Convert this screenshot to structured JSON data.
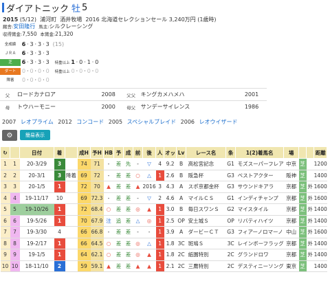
{
  "horse": {
    "name": "ダイアトニック",
    "sex": "牡",
    "age": "5",
    "birth": "2015",
    "birth_md": "(5/12)",
    "area": "浦河町",
    "breeder": "酒井牧場",
    "sale": "2016 北海道セレクションセール 3,240万円 (1歳時)",
    "trainer_label": "厩舎:",
    "trainer": "安田隆行",
    "owner_label": "馬主:",
    "owner": "シルクレーシング",
    "prize_label1": "収得賞金:",
    "prize1": "7,550",
    "prize_label2": "本賞金:",
    "prize2": "21,320"
  },
  "records": [
    {
      "cat": "全成績",
      "a": "6",
      "b": "3",
      "c": "3",
      "d": "3",
      "total": "(15)",
      "style": "plain"
    },
    {
      "cat": "ＪＲＡ",
      "a": "6",
      "b": "3",
      "c": "3",
      "d": "3",
      "total": "",
      "style": "plain"
    },
    {
      "cat": "芝",
      "a": "6",
      "b": "3",
      "c": "3",
      "d": "3",
      "sub": "特重以上",
      "sa": "1",
      "sb": "0",
      "sc": "1",
      "sd": "0",
      "style": "turf"
    },
    {
      "cat": "ダート",
      "a": "0",
      "b": "0",
      "c": "0",
      "d": "0",
      "sub": "特重以上",
      "sa": "0",
      "sb": "0",
      "sc": "0",
      "sd": "0",
      "style": "dirt"
    },
    {
      "cat": "障害",
      "a": "0",
      "b": "0",
      "c": "0",
      "d": "0",
      "total": "",
      "style": "plain"
    }
  ],
  "pedigree": [
    {
      "label": "父",
      "name": "ロードカナロア",
      "year": "2008",
      "label2": "父父",
      "name2": "キングカメハメハ",
      "year2": "2001"
    },
    {
      "label": "母",
      "name": "トウハーモニー",
      "year": "2000",
      "label2": "母父",
      "name2": "サンデーサイレンス",
      "year2": "1986"
    }
  ],
  "grandsibs": [
    {
      "year": "2007",
      "name": "レオプライム"
    },
    {
      "year": "2012",
      "name": "コンコード"
    },
    {
      "year": "2005",
      "name": "スペシャルブレイド"
    },
    {
      "year": "2006",
      "name": "レオウイザード"
    }
  ],
  "buttons": {
    "simple": "簡易表示",
    "gear": "⚙"
  },
  "table": {
    "headers": [
      "↻",
      "",
      "日付",
      "着",
      "",
      "成H",
      "予H",
      "HB",
      "予",
      "成",
      "前",
      "後",
      "人",
      "オッ",
      "Lv",
      "レース名",
      "条",
      "1(2)着馬名",
      "場",
      "",
      "",
      "距離"
    ],
    "rows": [
      {
        "no": "1",
        "d": "1",
        "date": "20-3/29",
        "rank": "3",
        "note": "",
        "h": "74",
        "yh": "71",
        "hb": "-",
        "y": "差",
        "s": "先",
        "m": "-",
        "b": "▽",
        "p": "4",
        "o": "9.2",
        "lv": "B",
        "race": "高松宮記念",
        "cls": "G1",
        "horse": "モズスーパーフレア",
        "place": "中京",
        "tr": "芝",
        "cond": "",
        "dist": "1200"
      },
      {
        "no": "2",
        "d": "2",
        "date": "20-3/1",
        "rank": "3",
        "note": "降着",
        "h": "69",
        "yh": "72",
        "hb": "-",
        "y": "差",
        "s": "差",
        "m": "○",
        "b": "△",
        "p": "1",
        "o": "2.6",
        "lv": "B",
        "race": "阪急杯",
        "cls": "G3",
        "horse": "ベストアクター",
        "place": "阪神",
        "tr": "芝",
        "cond": "",
        "dist": "1400"
      },
      {
        "no": "3",
        "d": "3",
        "date": "20-1/5",
        "rank": "1",
        "note": "",
        "h": "72",
        "yh": "70",
        "hb": "▲",
        "y": "差",
        "s": "差",
        "m": "▲",
        "b": "2016",
        "p": "3",
        "o": "4.3",
        "lv": "A",
        "race": "スポ京都金杯",
        "cls": "G3",
        "horse": "サウンドキアラ",
        "place": "京都",
        "tr": "芝",
        "cond": "外",
        "dist": "1600"
      },
      {
        "no": "4",
        "d": "4",
        "date": "19-11/17",
        "rank": "10",
        "note": "",
        "h": "69",
        "yh": "72.3",
        "hb": "-",
        "y": "差",
        "s": "差",
        "m": "-",
        "b": "▽",
        "p": "2",
        "o": "4.6",
        "lv": "A",
        "race": "マイルＣＳ",
        "cls": "G1",
        "horse": "インディチャンプ",
        "place": "京都",
        "tr": "芝",
        "cond": "外",
        "dist": "1600"
      },
      {
        "no": "5",
        "d": "5",
        "date": "19-10/26",
        "rank": "1",
        "note": "",
        "h": "72",
        "yh": "68.4",
        "hb": "○",
        "y": "差",
        "s": "差",
        "m": "◎",
        "b": "▲",
        "p": "1",
        "o": "3.0",
        "lv": "B",
        "race": "毎日スワンＳ",
        "cls": "G2",
        "horse": "マイスタイル",
        "place": "京都",
        "tr": "芝",
        "cond": "外",
        "dist": "1400"
      },
      {
        "no": "6",
        "d": "6",
        "date": "19-5/26",
        "rank": "1",
        "note": "",
        "h": "70",
        "yh": "67.9",
        "hb": "注",
        "y": "追",
        "s": "差",
        "m": "△",
        "b": "◎",
        "p": "1",
        "o": "2.5",
        "lv": "OP",
        "race": "安土城Ｓ",
        "cls": "OP",
        "horse": "リバティハイツ",
        "place": "京都",
        "tr": "芝",
        "cond": "外",
        "dist": "1400"
      },
      {
        "no": "7",
        "d": "7",
        "date": "19-3/30",
        "rank": "4",
        "note": "",
        "h": "66",
        "yh": "66.8",
        "hb": "-",
        "y": "差",
        "s": "差",
        "m": "-",
        "b": "-",
        "p": "1",
        "o": "3.9",
        "lv": "A",
        "race": "ダービーＣＴ",
        "cls": "G3",
        "horse": "フィアーノロマーノ",
        "place": "中山",
        "tr": "芝",
        "cond": "外",
        "dist": "1600"
      },
      {
        "no": "8",
        "d": "8",
        "date": "19-2/17",
        "rank": "1",
        "note": "",
        "h": "66",
        "yh": "64.5",
        "hb": "○",
        "y": "差",
        "s": "差",
        "m": "◎",
        "b": "△",
        "p": "1",
        "o": "1.8",
        "lv": "3C",
        "race": "斑鳩Ｓ",
        "cls": "3C",
        "horse": "レインボーフラッグ",
        "place": "京都",
        "tr": "芝",
        "cond": "外",
        "dist": "1400"
      },
      {
        "no": "9",
        "d": "9",
        "date": "19-1/5",
        "rank": "1",
        "note": "",
        "h": "64",
        "yh": "62.1",
        "hb": "○",
        "y": "差",
        "s": "差",
        "m": "◎",
        "b": "▲",
        "p": "1",
        "o": "1.8",
        "lv": "2C",
        "race": "紙園特別",
        "cls": "2C",
        "horse": "グランドロワ",
        "place": "京都",
        "tr": "芝",
        "cond": "外",
        "dist": "1400"
      },
      {
        "no": "10",
        "d": "10",
        "date": "18-11/10",
        "rank": "2",
        "note": "",
        "h": "59",
        "yh": "59.1",
        "hb": "▲",
        "y": "差",
        "s": "差",
        "m": "▲",
        "b": "▲",
        "p": "1",
        "o": "2.1",
        "lv": "2C",
        "race": "三鷹特別",
        "cls": "2C",
        "horse": "デスティニーソング",
        "place": "東京",
        "tr": "芝",
        "cond": "",
        "dist": "1400"
      }
    ]
  }
}
